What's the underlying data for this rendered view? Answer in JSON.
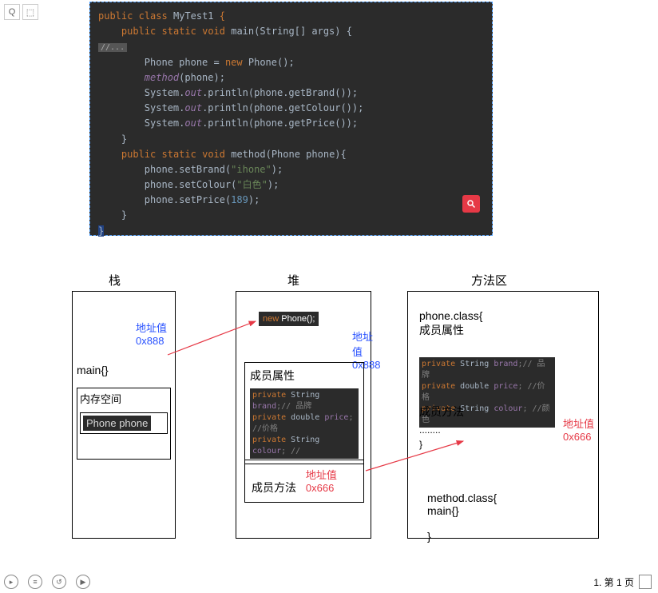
{
  "toolbar": {
    "btn1": "Q",
    "btn2": "⬚"
  },
  "code": {
    "l1_kw1": "public",
    "l1_kw2": "class",
    "l1_name": "MyTest1",
    "l1_brace": "{",
    "l2_kw1": "public",
    "l2_kw2": "static",
    "l2_kw3": "void",
    "l2_name": "main",
    "l2_rest": "(String[] args) {",
    "l3": "//...",
    "l4_a": "        Phone phone = ",
    "l4_kw": "new",
    "l4_b": " Phone();",
    "l5": "        method",
    "l5_b": "(phone);",
    "l6_a": "        System.",
    "l6_out": "out",
    "l6_b": ".println(phone.getBrand());",
    "l7_a": "        System.",
    "l7_out": "out",
    "l7_b": ".println(phone.getColour());",
    "l8_a": "        System.",
    "l8_out": "out",
    "l8_b": ".println(phone.getPrice());",
    "l9": "    }",
    "l10_kw1": "public",
    "l10_kw2": "static",
    "l10_kw3": "void",
    "l10_name": "method",
    "l10_rest": "(Phone phone){",
    "l11_a": "        phone.setBrand(",
    "l11_str": "\"ihone\"",
    "l11_b": ");",
    "l12_a": "        phone.setColour(",
    "l12_str": "\"白色\"",
    "l12_b": ");",
    "l13_a": "        phone.setPrice(",
    "l13_num": "189",
    "l13_b": ");",
    "l14": "    }",
    "l15": "}"
  },
  "diagram": {
    "stack": {
      "title": "栈",
      "main": "main{}",
      "mem_label": "内存空间",
      "phone_var": "Phone phone",
      "addr_label": "地址值",
      "addr_val": "0x888"
    },
    "heap": {
      "title": "堆",
      "new_kw": "new",
      "new_rest": " Phone();",
      "addr1_label": "地址值",
      "addr1_val": "0x888",
      "attr_title": "成员属性",
      "attr_line1_priv": "private",
      "attr_line1_type": " String ",
      "attr_line1_name": "brand",
      "attr_line1_cmt": ";// 品牌",
      "attr_line2_priv": "private",
      "attr_line2_type": "  double ",
      "attr_line2_name": "price",
      "attr_line2_cmt": "; //价格",
      "attr_line3_priv": "private",
      "attr_line3_type": " String ",
      "attr_line3_name": "colour",
      "attr_line3_cmt": "; //",
      "method_title": "成员方法",
      "method_addr_label": "地址值",
      "method_addr_val": "0x666"
    },
    "methodarea": {
      "title": "方法区",
      "phone_class_decl": "phone.class{",
      "member_attr": "成员属性",
      "line1_priv": "private",
      "line1_type": " String ",
      "line1_name": "brand",
      "line1_cmt": ";// 品牌",
      "line2_priv": "private",
      "line2_type": "  double ",
      "line2_name": "price",
      "line2_cmt": "; //价格",
      "line3_priv": "private",
      "line3_type": " String ",
      "line3_name": "colour",
      "line3_cmt": "; //颜色",
      "member_method": "成员方法",
      "dots": "........",
      "brace": "}",
      "addr_label": "地址值",
      "addr_val": "0x666",
      "method_class": "method.class{",
      "main_fn": "main{}",
      "brace2": "}"
    }
  },
  "footer": {
    "page": "1. 第 1 页"
  }
}
